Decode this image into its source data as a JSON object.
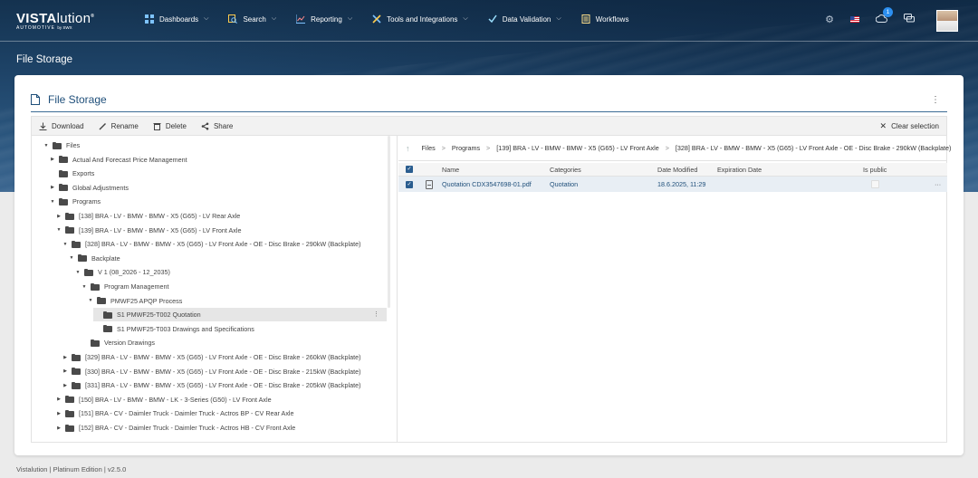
{
  "app": {
    "brand_main": "VISTA",
    "brand_light": "lution",
    "brand_sub": "AUTOMOTIVE",
    "brand_by": "by SWX"
  },
  "nav": {
    "items": [
      {
        "label": "Dashboards",
        "icon": "dashboard-icon",
        "dropdown": true
      },
      {
        "label": "Search",
        "icon": "search-icon",
        "dropdown": true
      },
      {
        "label": "Reporting",
        "icon": "chart-icon",
        "dropdown": true
      },
      {
        "label": "Tools and Integrations",
        "icon": "tools-icon",
        "dropdown": true
      },
      {
        "label": "Data Validation",
        "icon": "validation-icon",
        "dropdown": true
      },
      {
        "label": "Workflows",
        "icon": "workflow-icon",
        "dropdown": false
      }
    ],
    "notification_count": "1"
  },
  "page": {
    "title": "File Storage",
    "card_title": "File Storage"
  },
  "toolbar": {
    "download": "Download",
    "rename": "Rename",
    "delete": "Delete",
    "share": "Share",
    "clear_selection": "Clear selection"
  },
  "tree": [
    {
      "label": "Files",
      "depth": 0,
      "expanded": true
    },
    {
      "label": "Actual And Forecast Price Management",
      "depth": 1,
      "expanded": false
    },
    {
      "label": "Exports",
      "depth": 1,
      "leaf": true
    },
    {
      "label": "Global Adjustments",
      "depth": 1,
      "expanded": false
    },
    {
      "label": "Programs",
      "depth": 1,
      "expanded": true
    },
    {
      "label": "[138] BRA - LV - BMW - BMW - X5 (G65) - LV Rear Axle",
      "depth": 2,
      "expanded": false
    },
    {
      "label": "[139] BRA - LV - BMW - BMW - X5 (G65) - LV Front Axle",
      "depth": 2,
      "expanded": true
    },
    {
      "label": "[328] BRA - LV - BMW - BMW - X5 (G65) - LV Front Axle - OE - Disc Brake - 290kW (Backplate)",
      "depth": 3,
      "expanded": true
    },
    {
      "label": "Backplate",
      "depth": 4,
      "expanded": true
    },
    {
      "label": "V 1 (08_2026 - 12_2035)",
      "depth": 5,
      "expanded": true
    },
    {
      "label": "Program Management",
      "depth": 6,
      "expanded": true
    },
    {
      "label": "PMWF25 APQP Process",
      "depth": 7,
      "expanded": true
    },
    {
      "label": "S1 PMWF25-T002 Quotation",
      "depth": 8,
      "leaf": true,
      "selected": true
    },
    {
      "label": "S1 PMWF25-T003 Drawings and Specifications",
      "depth": 8,
      "leaf": true
    },
    {
      "label": "Version Drawings",
      "depth": 6,
      "leaf": true
    },
    {
      "label": "[329] BRA - LV - BMW - BMW - X5 (G65) - LV Front Axle - OE - Disc Brake - 260kW (Backplate)",
      "depth": 3,
      "expanded": false
    },
    {
      "label": "[330] BRA - LV - BMW - BMW - X5 (G65) - LV Front Axle - OE - Disc Brake - 215kW (Backplate)",
      "depth": 3,
      "expanded": false
    },
    {
      "label": "[331] BRA - LV - BMW - BMW - X5 (G65) - LV Front Axle - OE - Disc Brake - 205kW (Backplate)",
      "depth": 3,
      "expanded": false
    },
    {
      "label": "[150] BRA - LV - BMW - BMW - LK - 3-Series (G50) - LV Front Axle",
      "depth": 2,
      "expanded": false
    },
    {
      "label": "[151] BRA - CV - Daimler Truck - Daimler Truck - Actros BP - CV Rear Axle",
      "depth": 2,
      "expanded": false
    },
    {
      "label": "[152] BRA - CV - Daimler Truck - Daimler Truck - Actros HB - CV Front Axle",
      "depth": 2,
      "expanded": false
    }
  ],
  "breadcrumb": [
    "Files",
    "Programs",
    "[139] BRA - LV - BMW - BMW - X5 (G65) - LV Front Axle",
    "[328] BRA - LV - BMW - BMW - X5 (G65) - LV Front Axle - OE - Disc Brake - 290kW (Backplate)"
  ],
  "table": {
    "columns": {
      "name": "Name",
      "categories": "Categories",
      "date_modified": "Date Modified",
      "expiration_date": "Expiration Date",
      "is_public": "Is public"
    },
    "rows": [
      {
        "name": "Quotation CDX3547698-01.pdf",
        "categories": "Quotation",
        "date_modified": "18.6.2025, 11:29",
        "expiration_date": "",
        "selected": true
      }
    ]
  },
  "footer": {
    "text": "Vistalution | Platinum Edition | v2.5.0"
  },
  "colors": {
    "accent": "#1f4f7a",
    "header_bg": "#1d4266",
    "badge": "#2c8ff0"
  }
}
